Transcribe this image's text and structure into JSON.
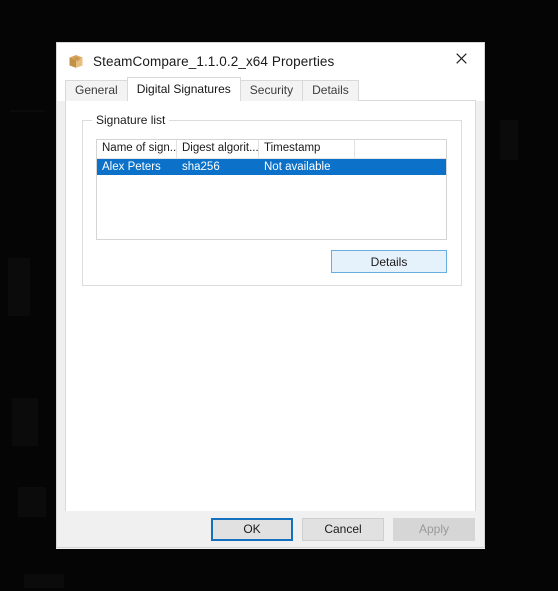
{
  "window": {
    "title": "SteamCompare_1.1.0.2_x64 Properties",
    "icon": "package-box-icon",
    "close_label": "×"
  },
  "tabs": [
    {
      "label": "General",
      "active": false
    },
    {
      "label": "Digital Signatures",
      "active": true
    },
    {
      "label": "Security",
      "active": false
    },
    {
      "label": "Details",
      "active": false
    }
  ],
  "signature_group": {
    "legend": "Signature list",
    "columns": [
      "Name of sign...",
      "Digest algorit...",
      "Timestamp"
    ],
    "rows": [
      {
        "name": "Alex Peters",
        "digest": "sha256",
        "timestamp": "Not available",
        "selected": true
      }
    ],
    "details_button": "Details"
  },
  "footer": {
    "ok": "OK",
    "cancel": "Cancel",
    "apply": "Apply"
  },
  "colors": {
    "selection": "#0b71c9",
    "focus_border": "#1570bd",
    "hover_fill": "#e5f1fb",
    "dialog_bg": "#f0f0f0"
  }
}
